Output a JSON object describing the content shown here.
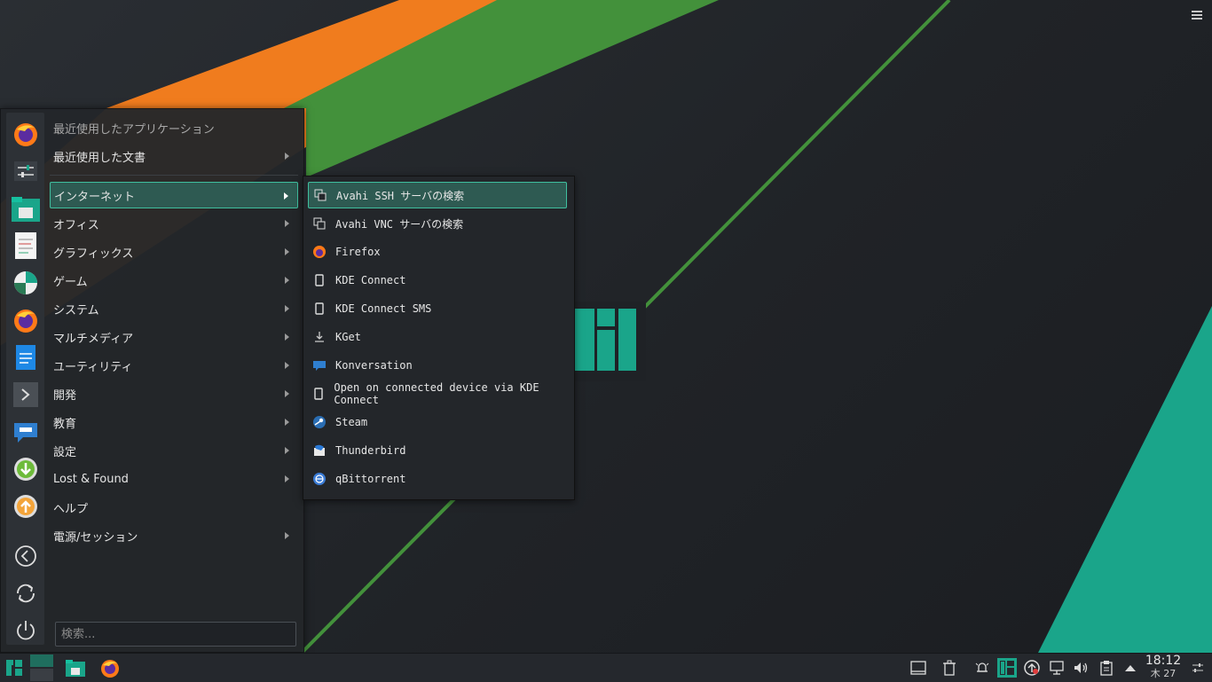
{
  "colors": {
    "accent": "#1aa58a",
    "orange": "#f07c1e",
    "green": "#43913b",
    "highlight_bg": "#2e5a52",
    "highlight_border": "#3fbf9f"
  },
  "launcher": {
    "favorites": [
      "firefox-icon",
      "settings-sliders-icon",
      "file-manager-icon",
      "text-editor-icon",
      "disk-usage-icon",
      "firefox-icon",
      "document-icon",
      "terminal-icon",
      "konversation-icon",
      "download-icon",
      "update-icon"
    ],
    "actions": [
      "back-icon",
      "refresh-icon",
      "power-icon"
    ],
    "header": "最近使用したアプリケーション",
    "items": [
      {
        "label": "最近使用した文書",
        "has_submenu": true
      },
      {
        "label": "インターネット",
        "has_submenu": true,
        "active": true
      },
      {
        "label": "オフィス",
        "has_submenu": true
      },
      {
        "label": "グラフィックス",
        "has_submenu": true
      },
      {
        "label": "ゲーム",
        "has_submenu": true
      },
      {
        "label": "システム",
        "has_submenu": true
      },
      {
        "label": "マルチメディア",
        "has_submenu": true
      },
      {
        "label": "ユーティリティ",
        "has_submenu": true
      },
      {
        "label": "開発",
        "has_submenu": true
      },
      {
        "label": "教育",
        "has_submenu": true
      },
      {
        "label": "設定",
        "has_submenu": true
      },
      {
        "label": "Lost & Found",
        "has_submenu": true
      },
      {
        "label": "ヘルプ",
        "has_submenu": false
      },
      {
        "label": "電源/セッション",
        "has_submenu": true
      }
    ],
    "search_placeholder": "検索..."
  },
  "submenu": {
    "items": [
      {
        "label": "Avahi SSH サーバの検索",
        "icon": "remote-icon",
        "active": true
      },
      {
        "label": "Avahi VNC サーバの検索",
        "icon": "remote-icon"
      },
      {
        "label": "Firefox",
        "icon": "firefox-icon"
      },
      {
        "label": "KDE Connect",
        "icon": "phone-icon"
      },
      {
        "label": "KDE Connect SMS",
        "icon": "phone-icon"
      },
      {
        "label": "KGet",
        "icon": "download-icon"
      },
      {
        "label": "Konversation",
        "icon": "chat-icon"
      },
      {
        "label": "Open on connected device via KDE Connect",
        "icon": "phone-icon"
      },
      {
        "label": "Steam",
        "icon": "steam-icon"
      },
      {
        "label": "Thunderbird",
        "icon": "thunderbird-icon"
      },
      {
        "label": "qBittorrent",
        "icon": "qbittorrent-icon"
      }
    ]
  },
  "taskbar": {
    "left": [
      "manjaro-menu-icon",
      "pager-icon",
      "file-manager-icon",
      "firefox-icon"
    ],
    "tray": [
      "show-desktop-icon",
      "trash-icon",
      "notifications-icon",
      "manjaro-settings-icon",
      "update-icon",
      "network-icon",
      "volume-icon",
      "clipboard-icon",
      "expand-tray-icon"
    ],
    "time": "18:12",
    "date": "木 27"
  }
}
